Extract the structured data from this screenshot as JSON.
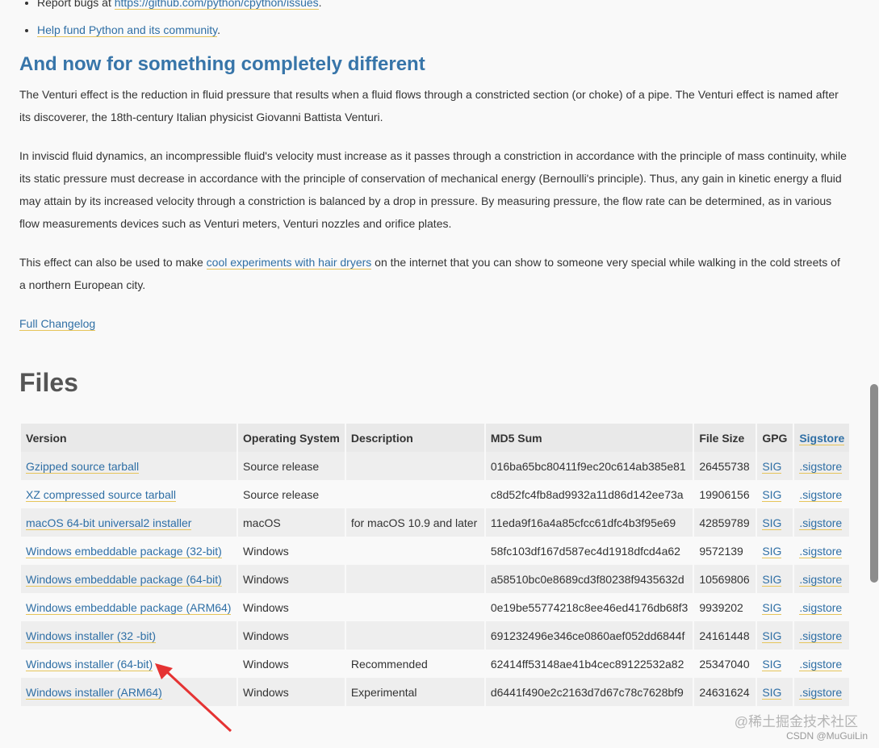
{
  "bullets": [
    {
      "prefix": "Report bugs at ",
      "link": "https://github.com/python/cpython/issues",
      "suffix": "."
    },
    {
      "prefix": "",
      "link": "Help fund Python and its community",
      "suffix": "."
    }
  ],
  "section_heading": "And now for something completely different",
  "paragraphs": {
    "p1": "The Venturi effect is the reduction in fluid pressure that results when a fluid flows through a constricted section (or choke) of a pipe. The Venturi effect is named after its discoverer, the 18th-century Italian physicist Giovanni Battista Venturi.",
    "p2": "In inviscid fluid dynamics, an incompressible fluid's velocity must increase as it passes through a constriction in accordance with the principle of mass continuity, while its static pressure must decrease in accordance with the principle of conservation of mechanical energy (Bernoulli's principle). Thus, any gain in kinetic energy a fluid may attain by its increased velocity through a constriction is balanced by a drop in pressure. By measuring pressure, the flow rate can be determined, as in various flow measurements devices such as Venturi meters, Venturi nozzles and orifice plates.",
    "p3_before": "This effect can also be used to make ",
    "p3_link": "cool experiments with hair dryers",
    "p3_after": " on the internet that you can show to someone very special while walking in the cold streets of a northern European city."
  },
  "changelog_link": "Full Changelog",
  "files_heading": "Files",
  "table": {
    "headers": {
      "version": "Version",
      "os": "Operating System",
      "description": "Description",
      "md5": "MD5 Sum",
      "size": "File Size",
      "gpg": "GPG",
      "sigstore": "Sigstore"
    },
    "rows": [
      {
        "version": "Gzipped source tarball",
        "os": "Source release",
        "description": "",
        "md5": "016ba65bc80411f9ec20c614ab385e81",
        "size": "26455738",
        "gpg": "SIG",
        "sigstore": ".sigstore"
      },
      {
        "version": "XZ compressed source tarball",
        "os": "Source release",
        "description": "",
        "md5": "c8d52fc4fb8ad9932a11d86d142ee73a",
        "size": "19906156",
        "gpg": "SIG",
        "sigstore": ".sigstore"
      },
      {
        "version": "macOS 64-bit universal2 installer",
        "os": "macOS",
        "description": "for macOS 10.9 and later",
        "md5": "11eda9f16a4a85cfcc61dfc4b3f95e69",
        "size": "42859789",
        "gpg": "SIG",
        "sigstore": ".sigstore"
      },
      {
        "version": "Windows embeddable package (32-bit)",
        "os": "Windows",
        "description": "",
        "md5": "58fc103df167d587ec4d1918dfcd4a62",
        "size": "9572139",
        "gpg": "SIG",
        "sigstore": ".sigstore"
      },
      {
        "version": "Windows embeddable package (64-bit)",
        "os": "Windows",
        "description": "",
        "md5": "a58510bc0e8689cd3f80238f9435632d",
        "size": "10569806",
        "gpg": "SIG",
        "sigstore": ".sigstore"
      },
      {
        "version": "Windows embeddable package (ARM64)",
        "os": "Windows",
        "description": "",
        "md5": "0e19be55774218c8ee46ed4176db68f3",
        "size": "9939202",
        "gpg": "SIG",
        "sigstore": ".sigstore"
      },
      {
        "version": "Windows installer (32 -bit)",
        "os": "Windows",
        "description": "",
        "md5": "691232496e346ce0860aef052dd6844f",
        "size": "24161448",
        "gpg": "SIG",
        "sigstore": ".sigstore"
      },
      {
        "version": "Windows installer (64-bit)",
        "os": "Windows",
        "description": "Recommended",
        "md5": "62414ff53148ae41b4cec89122532a82",
        "size": "25347040",
        "gpg": "SIG",
        "sigstore": ".sigstore"
      },
      {
        "version": "Windows installer (ARM64)",
        "os": "Windows",
        "description": "Experimental",
        "md5": "d6441f490e2c2163d7d67c78c7628bf9",
        "size": "24631624",
        "gpg": "SIG",
        "sigstore": ".sigstore"
      }
    ]
  },
  "annotation": {
    "arrow_color": "#e53333"
  },
  "watermark": {
    "line1": "@稀土掘金技术社区",
    "line2": "CSDN @MuGuiLin"
  },
  "colors": {
    "link": "#2f6fa5",
    "heading": "#3775a9",
    "link_underline": "#e6c55a"
  }
}
